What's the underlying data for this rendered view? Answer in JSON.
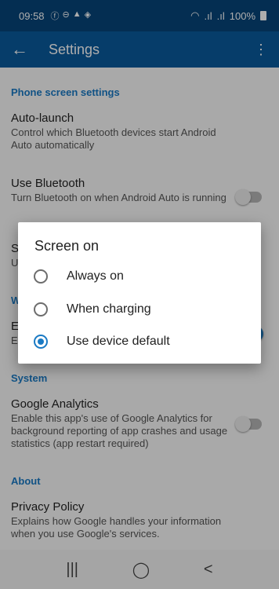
{
  "status_bar": {
    "time": "09:58",
    "left_icons": [
      "facebook-icon",
      "do-not-disturb-icon",
      "drive-icon",
      "android-auto-icon"
    ],
    "battery_percent": "100%"
  },
  "app_bar": {
    "title": "Settings",
    "back_icon": "arrow-left-icon",
    "menu_icon": "more-vert-icon"
  },
  "settings": {
    "phone_section": "Phone screen settings",
    "auto_launch": {
      "title": "Auto-launch",
      "summary": "Control which Bluetooth devices start Android Auto automatically"
    },
    "use_bluetooth": {
      "title": "Use Bluetooth",
      "summary": "Turn Bluetooth on when Android Auto is running",
      "enabled": false
    },
    "partial_item_letter": "S",
    "partial_item_summary_letter": "U",
    "partial_section_letter": "W",
    "partial_item2_letter": "E",
    "partial_item2_summary_letter": "E",
    "partial_item2_enabled": true,
    "system_section": "System",
    "google_analytics": {
      "title": "Google Analytics",
      "summary": "Enable this app's use of Google Analytics for background reporting of app crashes and usage statistics (app restart required)",
      "enabled": false
    },
    "about_section": "About",
    "privacy_policy": {
      "title": "Privacy Policy",
      "summary": "Explains how Google handles your information when you use Google's services."
    }
  },
  "dialog": {
    "title": "Screen on",
    "options": [
      {
        "label": "Always on",
        "selected": false
      },
      {
        "label": "When charging",
        "selected": false
      },
      {
        "label": "Use device default",
        "selected": true
      }
    ]
  },
  "nav_bar": {
    "recents_glyph": "|||",
    "home_glyph": "◯",
    "back_glyph": "<"
  },
  "colors": {
    "status_bar": "#07447a",
    "app_bar": "#0a5a9c",
    "accent": "#1a7ac4"
  }
}
